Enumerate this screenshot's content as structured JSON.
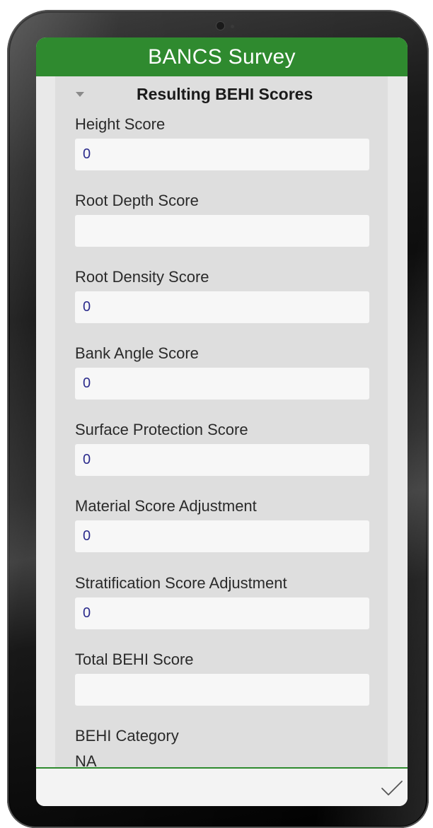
{
  "app": {
    "title": "BANCS Survey"
  },
  "section": {
    "title": "Resulting BEHI Scores",
    "icon": "chevron-down-icon"
  },
  "fields": [
    {
      "label": "Height Score",
      "value": "0",
      "placeholder": ""
    },
    {
      "label": "Root Depth Score",
      "value": "",
      "placeholder": ""
    },
    {
      "label": "Root Density Score",
      "value": "0",
      "placeholder": ""
    },
    {
      "label": "Bank Angle Score",
      "value": "0",
      "placeholder": ""
    },
    {
      "label": "Surface Protection Score",
      "value": "0",
      "placeholder": ""
    },
    {
      "label": "Material Score Adjustment",
      "value": "0",
      "placeholder": ""
    },
    {
      "label": "Stratification Score Adjustment",
      "value": "0",
      "placeholder": ""
    },
    {
      "label": "Total BEHI Score",
      "value": "",
      "placeholder": ""
    }
  ],
  "category": {
    "label": "BEHI Category",
    "value": "NA"
  },
  "footer": {
    "submit_icon": "checkmark-icon"
  },
  "colors": {
    "header_green": "#2f8a2f",
    "value_text": "#2b2b8c"
  }
}
